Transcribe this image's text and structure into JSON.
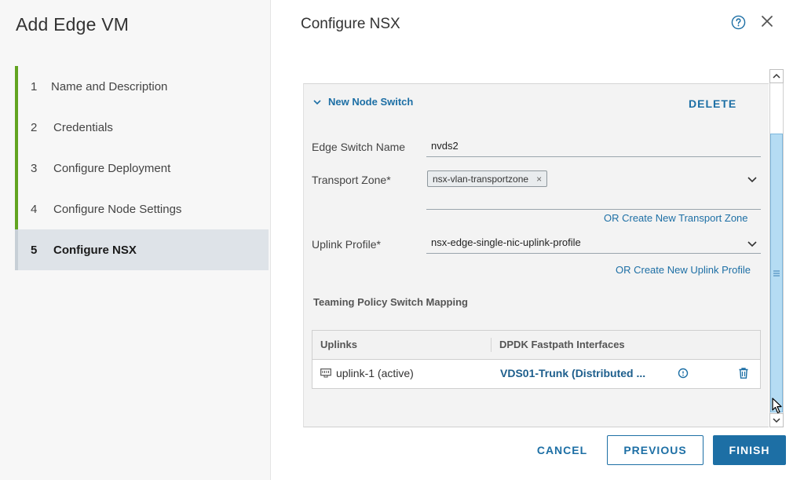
{
  "wizard": {
    "title": "Add Edge VM",
    "steps": [
      {
        "num": "1",
        "label": "Name and Description"
      },
      {
        "num": "2",
        "label": "Credentials"
      },
      {
        "num": "3",
        "label": "Configure Deployment"
      },
      {
        "num": "4",
        "label": "Configure Node Settings"
      },
      {
        "num": "5",
        "label": "Configure NSX",
        "active": true
      }
    ]
  },
  "main": {
    "title": "Configure NSX",
    "section": {
      "title": "New Node Switch",
      "delete_label": "DELETE"
    },
    "edge_switch": {
      "label": "Edge Switch Name",
      "value": "nvds2"
    },
    "transport_zone": {
      "label": "Transport Zone",
      "required_mark": "*",
      "chip": "nsx-vlan-transportzone",
      "chip_remove": "×",
      "create_link": "OR Create New Transport Zone"
    },
    "uplink_profile": {
      "label": "Uplink Profile",
      "required_mark": "*",
      "value": "nsx-edge-single-nic-uplink-profile",
      "create_link": "OR Create New Uplink Profile"
    },
    "teaming": {
      "title": "Teaming Policy Switch Mapping",
      "columns": [
        "Uplinks",
        "DPDK Fastpath Interfaces"
      ],
      "rows": [
        {
          "uplink": "uplink-1 (active)",
          "interface": "VDS01-Trunk (Distributed ..."
        }
      ]
    }
  },
  "footer": {
    "cancel": "CANCEL",
    "previous": "PREVIOUS",
    "finish": "FINISH"
  },
  "colors": {
    "accent": "#1d6fa5",
    "step_done": "#62a420",
    "step_active_bg": "#dee3e8"
  }
}
